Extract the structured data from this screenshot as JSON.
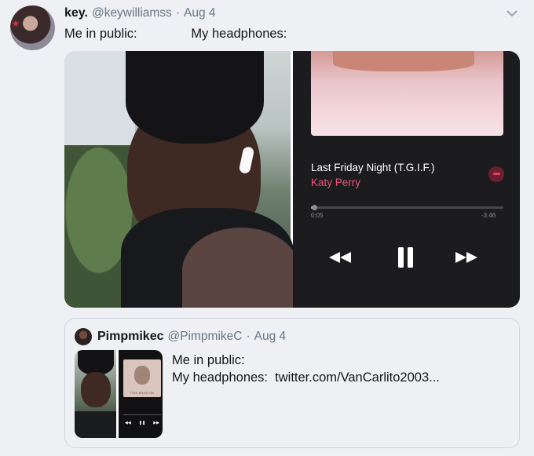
{
  "tweet": {
    "display_name": "key.",
    "handle": "@keywilliamss",
    "separator": "·",
    "date": "Aug 4",
    "text": "Me in public:               My headphones:",
    "avatar_icon": "profile-avatar"
  },
  "media": {
    "player": {
      "track_title": "Last Friday Night (T.G.I.F.)",
      "track_artist": "Katy Perry",
      "more_label": "•••",
      "time_elapsed": "0:05",
      "time_remaining": "-3:46",
      "progress": 0.02,
      "accent_color": "#f0507a",
      "controls": [
        "rewind-icon",
        "pause-icon",
        "fast-forward-icon"
      ]
    }
  },
  "quote": {
    "display_name": "Pimpmikec",
    "handle": "@PimpmikeC",
    "separator": "·",
    "date": "Aug 4",
    "line1": "Me in public:",
    "line2": "My headphones:  twitter.com/VanCarlito2003...",
    "thumb_album_text": "TONI BRAXTON"
  }
}
